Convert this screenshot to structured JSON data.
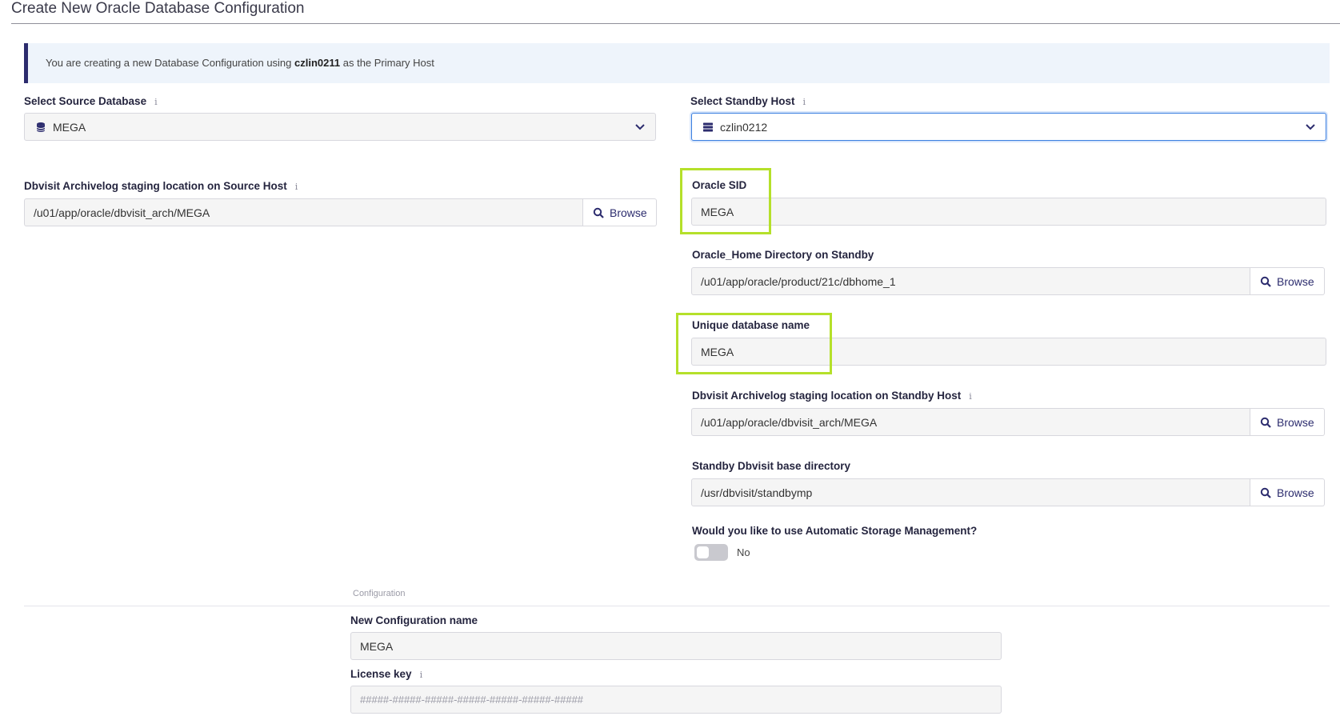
{
  "page": {
    "title": "Create New Oracle Database Configuration"
  },
  "banner": {
    "prefix": "You are creating a new Database Configuration using ",
    "host": "czlin0211",
    "suffix": " as the Primary Host"
  },
  "source_db": {
    "label": "Select Source Database",
    "value": "MEGA",
    "icon": "database-icon"
  },
  "standby_host": {
    "label": "Select Standby Host",
    "value": "czlin0212",
    "icon": "server-icon"
  },
  "source_staging": {
    "label": "Dbvisit Archivelog staging location on Source Host",
    "value": "/u01/app/oracle/dbvisit_arch/MEGA",
    "browse_label": "Browse"
  },
  "oracle_sid": {
    "label": "Oracle SID",
    "value": "MEGA"
  },
  "oracle_home": {
    "label": "Oracle_Home Directory on Standby",
    "value": "/u01/app/oracle/product/21c/dbhome_1",
    "browse_label": "Browse"
  },
  "unique_db_name": {
    "label": "Unique database name",
    "value": "MEGA"
  },
  "standby_staging": {
    "label": "Dbvisit Archivelog staging location on Standby Host",
    "value": "/u01/app/oracle/dbvisit_arch/MEGA",
    "browse_label": "Browse"
  },
  "standby_base": {
    "label": "Standby Dbvisit base directory",
    "value": "/usr/dbvisit/standbymp",
    "browse_label": "Browse"
  },
  "asm": {
    "label": "Would you like to use Automatic Storage Management?",
    "toggle_text": "No"
  },
  "configuration": {
    "caption": "Configuration",
    "name_label": "New Configuration name",
    "name_value": "MEGA",
    "license_label": "License key",
    "license_placeholder": "#####-#####-#####-#####-#####-#####-#####"
  },
  "colors": {
    "accent": "#2c2c6e",
    "highlight": "#b5e02a",
    "focus": "#3b7fe0",
    "banner_bg": "#eef4fb"
  }
}
